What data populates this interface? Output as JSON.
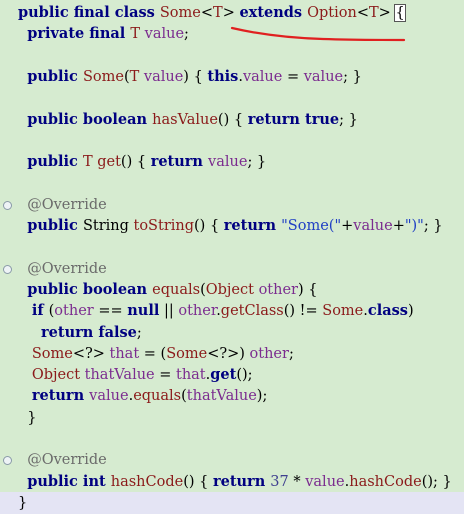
{
  "editor": {
    "lines": [
      {
        "tokens": [
          {
            "c": "kw",
            "t": "public final class "
          },
          {
            "c": "ty",
            "t": "Some"
          },
          {
            "c": "plain",
            "t": "<"
          },
          {
            "c": "ty",
            "t": "T"
          },
          {
            "c": "plain",
            "t": "> "
          },
          {
            "c": "kw",
            "t": "extends "
          },
          {
            "c": "ty",
            "t": "Option"
          },
          {
            "c": "plain",
            "t": "<"
          },
          {
            "c": "ty",
            "t": "T"
          },
          {
            "c": "plain",
            "t": "> "
          },
          {
            "c": "plain",
            "t": "{",
            "h": true
          }
        ]
      },
      {
        "tokens": [
          {
            "c": "plain",
            "t": "  "
          },
          {
            "c": "kw",
            "t": "private final "
          },
          {
            "c": "ty",
            "t": "T "
          },
          {
            "c": "fld",
            "t": "value"
          },
          {
            "c": "plain",
            "t": ";"
          }
        ]
      },
      {
        "tokens": []
      },
      {
        "tokens": [
          {
            "c": "plain",
            "t": "  "
          },
          {
            "c": "kw",
            "t": "public "
          },
          {
            "c": "ty",
            "t": "Some"
          },
          {
            "c": "plain",
            "t": "("
          },
          {
            "c": "ty",
            "t": "T "
          },
          {
            "c": "par",
            "t": "value"
          },
          {
            "c": "plain",
            "t": ") { "
          },
          {
            "c": "kw",
            "t": "this"
          },
          {
            "c": "plain",
            "t": "."
          },
          {
            "c": "fld",
            "t": "value"
          },
          {
            "c": "plain",
            "t": " = "
          },
          {
            "c": "par",
            "t": "value"
          },
          {
            "c": "plain",
            "t": "; }"
          }
        ]
      },
      {
        "tokens": []
      },
      {
        "tokens": [
          {
            "c": "plain",
            "t": "  "
          },
          {
            "c": "kw",
            "t": "public boolean "
          },
          {
            "c": "ty",
            "t": "hasValue"
          },
          {
            "c": "plain",
            "t": "() { "
          },
          {
            "c": "kw",
            "t": "return true"
          },
          {
            "c": "plain",
            "t": "; }"
          }
        ]
      },
      {
        "tokens": []
      },
      {
        "tokens": [
          {
            "c": "plain",
            "t": "  "
          },
          {
            "c": "kw",
            "t": "public "
          },
          {
            "c": "ty",
            "t": "T "
          },
          {
            "c": "ty",
            "t": "get"
          },
          {
            "c": "plain",
            "t": "() { "
          },
          {
            "c": "kw",
            "t": "return "
          },
          {
            "c": "fld",
            "t": "value"
          },
          {
            "c": "plain",
            "t": "; }"
          }
        ]
      },
      {
        "tokens": []
      },
      {
        "fold": "⊖",
        "tokens": [
          {
            "c": "plain",
            "t": "  "
          },
          {
            "c": "ann",
            "t": "@Override"
          }
        ]
      },
      {
        "tokens": [
          {
            "c": "plain",
            "t": "  "
          },
          {
            "c": "kw",
            "t": "public "
          },
          {
            "c": "plain",
            "t": "String "
          },
          {
            "c": "ty",
            "t": "toString"
          },
          {
            "c": "plain",
            "t": "() { "
          },
          {
            "c": "kw",
            "t": "return "
          },
          {
            "c": "str",
            "t": "\"Some(\""
          },
          {
            "c": "plain",
            "t": "+"
          },
          {
            "c": "fld",
            "t": "value"
          },
          {
            "c": "plain",
            "t": "+"
          },
          {
            "c": "str",
            "t": "\")\""
          },
          {
            "c": "plain",
            "t": "; }"
          }
        ]
      },
      {
        "tokens": []
      },
      {
        "fold": "⊖",
        "tokens": [
          {
            "c": "plain",
            "t": "  "
          },
          {
            "c": "ann",
            "t": "@Override"
          }
        ]
      },
      {
        "tokens": [
          {
            "c": "plain",
            "t": "  "
          },
          {
            "c": "kw",
            "t": "public boolean "
          },
          {
            "c": "ty",
            "t": "equals"
          },
          {
            "c": "plain",
            "t": "("
          },
          {
            "c": "ty",
            "t": "Object "
          },
          {
            "c": "par",
            "t": "other"
          },
          {
            "c": "plain",
            "t": ") {"
          }
        ]
      },
      {
        "tokens": [
          {
            "c": "plain",
            "t": "   "
          },
          {
            "c": "kw",
            "t": "if "
          },
          {
            "c": "plain",
            "t": "("
          },
          {
            "c": "par",
            "t": "other"
          },
          {
            "c": "plain",
            "t": " == "
          },
          {
            "c": "kw",
            "t": "null"
          },
          {
            "c": "plain",
            "t": " || "
          },
          {
            "c": "par",
            "t": "other"
          },
          {
            "c": "plain",
            "t": "."
          },
          {
            "c": "ty",
            "t": "getClass"
          },
          {
            "c": "plain",
            "t": "() != "
          },
          {
            "c": "ty",
            "t": "Some"
          },
          {
            "c": "plain",
            "t": "."
          },
          {
            "c": "kw",
            "t": "class"
          },
          {
            "c": "plain",
            "t": ")"
          }
        ]
      },
      {
        "tokens": [
          {
            "c": "plain",
            "t": "     "
          },
          {
            "c": "kw",
            "t": "return false"
          },
          {
            "c": "plain",
            "t": ";"
          }
        ]
      },
      {
        "tokens": [
          {
            "c": "plain",
            "t": "   "
          },
          {
            "c": "ty",
            "t": "Some"
          },
          {
            "c": "plain",
            "t": "<?> "
          },
          {
            "c": "loc",
            "t": "that"
          },
          {
            "c": "plain",
            "t": " = ("
          },
          {
            "c": "ty",
            "t": "Some"
          },
          {
            "c": "plain",
            "t": "<?>) "
          },
          {
            "c": "par",
            "t": "other"
          },
          {
            "c": "plain",
            "t": ";"
          }
        ]
      },
      {
        "tokens": [
          {
            "c": "plain",
            "t": "   "
          },
          {
            "c": "ty",
            "t": "Object "
          },
          {
            "c": "loc",
            "t": "thatValue"
          },
          {
            "c": "plain",
            "t": " = "
          },
          {
            "c": "loc",
            "t": "that"
          },
          {
            "c": "plain",
            "t": "."
          },
          {
            "c": "kw",
            "t": "get"
          },
          {
            "c": "plain",
            "t": "();"
          }
        ]
      },
      {
        "tokens": [
          {
            "c": "plain",
            "t": "   "
          },
          {
            "c": "kw",
            "t": "return "
          },
          {
            "c": "fld",
            "t": "value"
          },
          {
            "c": "plain",
            "t": "."
          },
          {
            "c": "ty",
            "t": "equals"
          },
          {
            "c": "plain",
            "t": "("
          },
          {
            "c": "loc",
            "t": "thatValue"
          },
          {
            "c": "plain",
            "t": ");"
          }
        ]
      },
      {
        "tokens": [
          {
            "c": "plain",
            "t": "  }"
          }
        ]
      },
      {
        "tokens": []
      },
      {
        "fold": "⊖",
        "tokens": [
          {
            "c": "plain",
            "t": "  "
          },
          {
            "c": "ann",
            "t": "@Override"
          }
        ]
      },
      {
        "tokens": [
          {
            "c": "plain",
            "t": "  "
          },
          {
            "c": "kw",
            "t": "public int "
          },
          {
            "c": "ty",
            "t": "hashCode"
          },
          {
            "c": "plain",
            "t": "() { "
          },
          {
            "c": "kw",
            "t": "return "
          },
          {
            "c": "num",
            "t": "37"
          },
          {
            "c": "plain",
            "t": " * "
          },
          {
            "c": "fld",
            "t": "value"
          },
          {
            "c": "plain",
            "t": "."
          },
          {
            "c": "ty",
            "t": "hashCode"
          },
          {
            "c": "plain",
            "t": "(); }"
          }
        ]
      },
      {
        "current": true,
        "tokens": [
          {
            "c": "plain",
            "t": "}"
          }
        ]
      }
    ]
  },
  "colors": {
    "background": "#d6ebd0",
    "keyword": "#000080",
    "type": "#8b1a1a",
    "field": "#7b2c8f",
    "string": "#1f3fc4",
    "number": "#3f3f8f",
    "annotation": "#6b6b6b",
    "current_line": "#e4e4f4",
    "squiggle": "#e02020"
  }
}
